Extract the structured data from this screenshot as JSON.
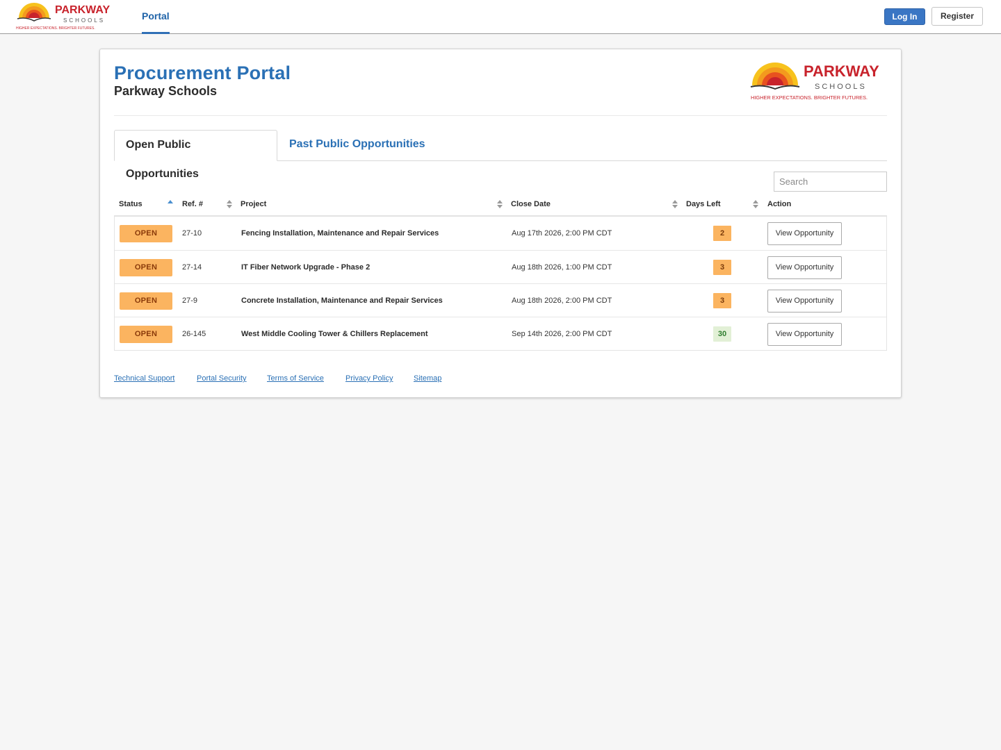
{
  "brand": {
    "wordmark": "PARKWAY",
    "subtitle": "SCHOOLS",
    "tagline": "HIGHER EXPECTATIONS. BRIGHTER FUTURES.",
    "colors": {
      "primary": "#c8232c",
      "sun_orange": "#f39a1e",
      "sun_yellow": "#f7c21d"
    }
  },
  "nav": {
    "portal_label": "Portal",
    "login_label": "Log In",
    "register_label": "Register"
  },
  "header": {
    "title": "Procurement Portal",
    "subtitle": "Parkway Schools"
  },
  "tabs": [
    {
      "label": "Open Public Opportunities",
      "active": true
    },
    {
      "label": "Past Public Opportunities",
      "active": false
    }
  ],
  "search": {
    "placeholder": "Search",
    "value": ""
  },
  "table": {
    "columns": [
      "Status",
      "Ref. #",
      "Project",
      "Close Date",
      "Days Left",
      "Action"
    ],
    "sorted_column": "Status",
    "sort_direction": "ascending",
    "rows": [
      {
        "status": "OPEN",
        "ref": "27-10",
        "project": "Fencing Installation, Maintenance and Repair Services",
        "close_date": "Aug 17th 2026, 2:00 PM CDT",
        "days_left": "2",
        "action": "View Opportunity"
      },
      {
        "status": "OPEN",
        "ref": "27-14",
        "project": "IT Fiber Network Upgrade - Phase 2",
        "close_date": "Aug 18th 2026, 1:00 PM CDT",
        "days_left": "3",
        "action": "View Opportunity"
      },
      {
        "status": "OPEN",
        "ref": "27-9",
        "project": "Concrete Installation, Maintenance and Repair Services",
        "close_date": "Aug 18th 2026, 2:00 PM CDT",
        "days_left": "3",
        "action": "View Opportunity"
      },
      {
        "status": "OPEN",
        "ref": "26-145",
        "project": "West Middle Cooling Tower & Chillers Replacement",
        "close_date": "Sep 14th 2026, 2:00 PM CDT",
        "days_left": "30",
        "action": "View Opportunity"
      }
    ]
  },
  "footer": {
    "links": [
      "Technical Support",
      "Portal Security",
      "Terms of Service",
      "Privacy Policy",
      "Sitemap"
    ]
  },
  "colors": {
    "accent_blue": "#2a70b5",
    "status_open_bg": "#fbb460",
    "days_warning_bg": "#fbb460",
    "days_ok_bg": "#e2f0d6"
  }
}
